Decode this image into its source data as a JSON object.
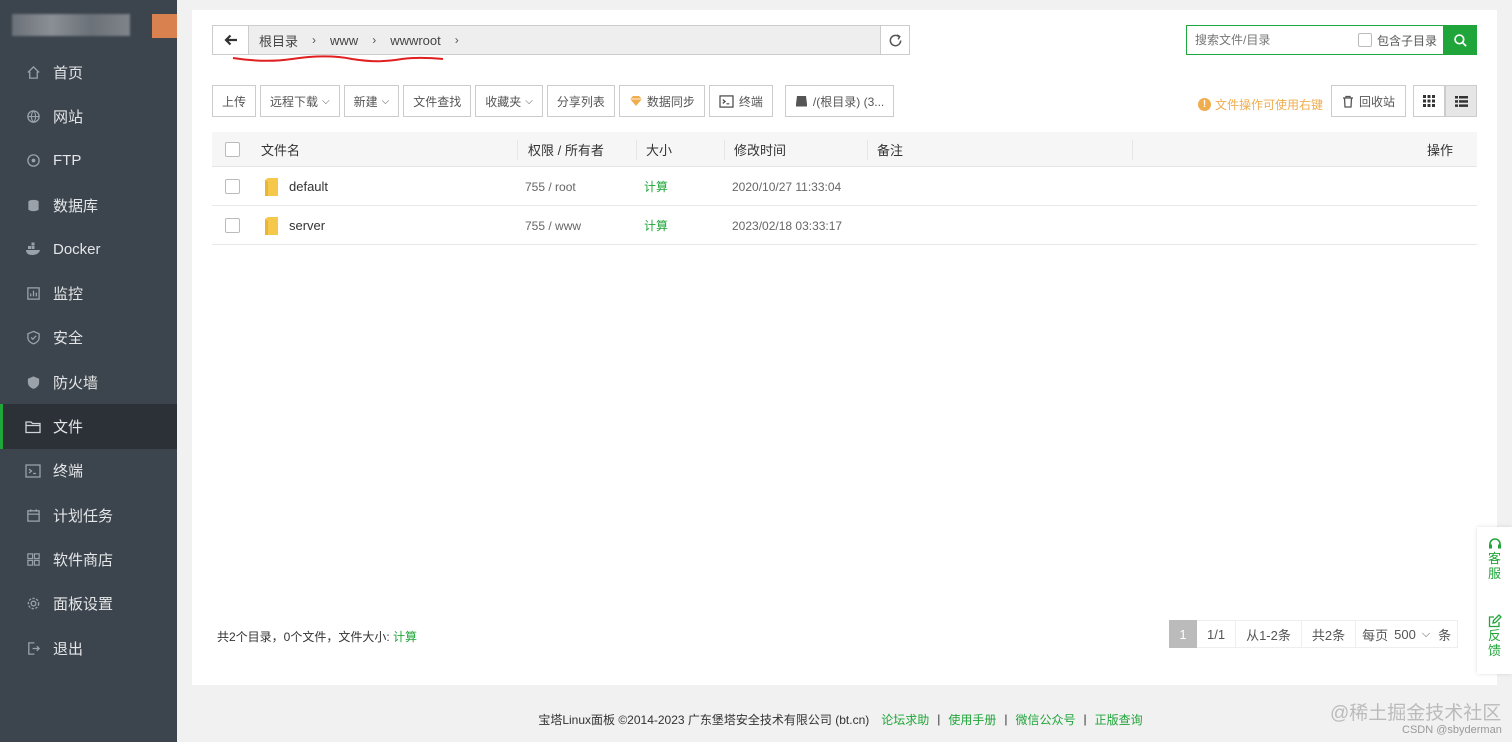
{
  "sidebar": {
    "items": [
      {
        "label": "首页",
        "icon": "home-icon"
      },
      {
        "label": "网站",
        "icon": "globe-icon"
      },
      {
        "label": "FTP",
        "icon": "ftp-icon"
      },
      {
        "label": "数据库",
        "icon": "database-icon"
      },
      {
        "label": "Docker",
        "icon": "docker-icon"
      },
      {
        "label": "监控",
        "icon": "monitor-icon"
      },
      {
        "label": "安全",
        "icon": "shield-icon"
      },
      {
        "label": "防火墙",
        "icon": "firewall-icon"
      },
      {
        "label": "文件",
        "icon": "folder-icon",
        "active": true
      },
      {
        "label": "终端",
        "icon": "terminal-icon"
      },
      {
        "label": "计划任务",
        "icon": "calendar-icon"
      },
      {
        "label": "软件商店",
        "icon": "apps-icon"
      },
      {
        "label": "面板设置",
        "icon": "settings-icon"
      },
      {
        "label": "退出",
        "icon": "logout-icon"
      }
    ]
  },
  "path": {
    "crumbs": [
      "根目录",
      "www",
      "wwwroot"
    ]
  },
  "search": {
    "placeholder": "搜索文件/目录",
    "include_sub": "包含子目录"
  },
  "toolbar": {
    "upload": "上传",
    "remote_download": "远程下载",
    "new": "新建",
    "file_search": "文件查找",
    "favorites": "收藏夹",
    "share_list": "分享列表",
    "data_sync": "数据同步",
    "terminal": "终端",
    "disk": "/(根目录) (3..."
  },
  "tip": "文件操作可使用右键",
  "recycle": "回收站",
  "table": {
    "headers": {
      "name": "文件名",
      "perm": "权限 / 所有者",
      "size": "大小",
      "mtime": "修改时间",
      "note": "备注",
      "ops": "操作"
    },
    "rows": [
      {
        "name": "default",
        "perm": "755 / root",
        "size": "计算",
        "mtime": "2020/10/27 11:33:04"
      },
      {
        "name": "server",
        "perm": "755 / www",
        "size": "计算",
        "mtime": "2023/02/18 03:33:17"
      }
    ]
  },
  "summary": {
    "text": "共2个目录，0个文件，文件大小:",
    "calc": "计算"
  },
  "pager": {
    "current": "1",
    "pages": "1/1",
    "range": "从1-2条",
    "total": "共2条",
    "per_page_label": "每页",
    "per_page": "500",
    "unit": "条"
  },
  "float_panel": {
    "service": "客服",
    "feedback": "反馈"
  },
  "footer": {
    "copyright": "宝塔Linux面板 ©2014-2023 广东堡塔安全技术有限公司 (bt.cn)",
    "links": [
      "论坛求助",
      "使用手册",
      "微信公众号",
      "正版查询"
    ]
  },
  "watermark": {
    "main": "@稀土掘金技术社区",
    "sub": "CSDN @sbyderman"
  },
  "colors": {
    "accent": "#20a53a",
    "sidebar": "#3c444d",
    "warning": "#f0ad4e"
  }
}
